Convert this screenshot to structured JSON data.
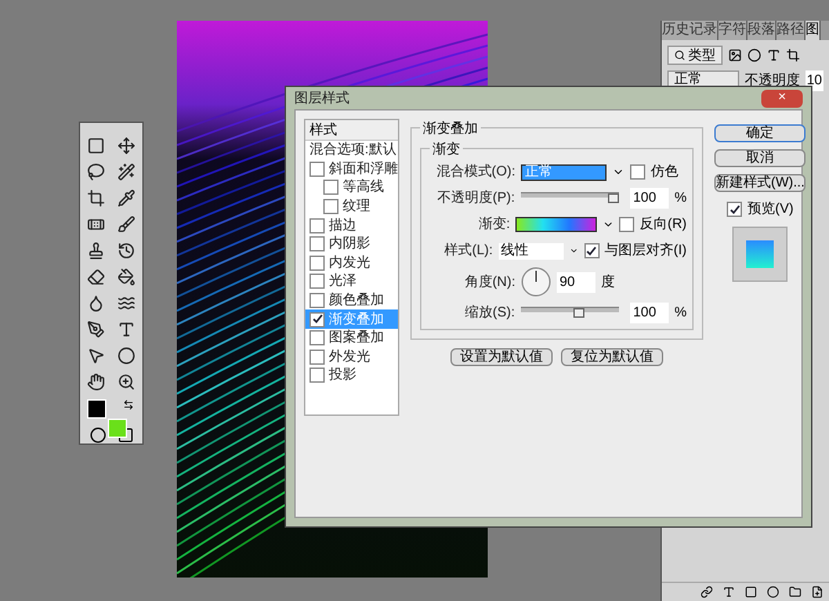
{
  "panel": {
    "tabs": [
      {
        "label": "历史记录",
        "selected": false
      },
      {
        "label": "字符",
        "selected": false
      },
      {
        "label": "段落",
        "selected": false
      },
      {
        "label": "路径",
        "selected": false
      },
      {
        "label": "图",
        "selected": true
      }
    ],
    "filter": "类型",
    "blend": "正常",
    "opacity_label": "不透明度",
    "opacity_value": "10"
  },
  "dialog": {
    "title": "图层样式",
    "close": "×",
    "styles_header": "样式",
    "styles": [
      {
        "label": "混合选项:默认",
        "kind": "header",
        "selected": false
      },
      {
        "label": "斜面和浮雕",
        "kind": "check",
        "checked": false,
        "selected": false,
        "children": [
          {
            "label": "等高线",
            "kind": "check",
            "checked": false,
            "selected": false
          },
          {
            "label": "纹理",
            "kind": "check",
            "checked": false,
            "selected": false
          }
        ]
      },
      {
        "label": "描边",
        "kind": "check",
        "checked": false,
        "selected": false
      },
      {
        "label": "内阴影",
        "kind": "check",
        "checked": false,
        "selected": false
      },
      {
        "label": "内发光",
        "kind": "check",
        "checked": false,
        "selected": false
      },
      {
        "label": "光泽",
        "kind": "check",
        "checked": false,
        "selected": false
      },
      {
        "label": "颜色叠加",
        "kind": "check",
        "checked": false,
        "selected": false
      },
      {
        "label": "渐变叠加",
        "kind": "check",
        "checked": true,
        "selected": true
      },
      {
        "label": "图案叠加",
        "kind": "check",
        "checked": false,
        "selected": false
      },
      {
        "label": "外发光",
        "kind": "check",
        "checked": false,
        "selected": false
      },
      {
        "label": "投影",
        "kind": "check",
        "checked": false,
        "selected": false
      }
    ],
    "group_title": "渐变叠加",
    "subgroup_title": "渐变",
    "blend_label": "混合模式(O):",
    "blend_value": "正常",
    "dither": {
      "label": "仿色",
      "checked": false
    },
    "opacity_label": "不透明度(P):",
    "opacity": {
      "level": 1.0
    },
    "opacity_value": "100",
    "opacity_unit": "%",
    "gradient_label": "渐变:",
    "reverse": {
      "label": "反向(R)",
      "checked": false
    },
    "style_label": "样式(L):",
    "style_value": "线性",
    "align": {
      "label": "与图层对齐(I)",
      "checked": true
    },
    "angle_label": "角度(N):",
    "angle_value": "90",
    "angle_unit": "度",
    "scale_label": "缩放(S):",
    "scale": {
      "level": 0.6
    },
    "scale_value": "100",
    "scale_unit": "%",
    "default_buttons": [
      "设置为默认值",
      "复位为默认值"
    ],
    "buttons": [
      "确定",
      "取消",
      "新建样式(W)..."
    ],
    "preview": {
      "label": "预览(V)",
      "checked": true
    }
  }
}
